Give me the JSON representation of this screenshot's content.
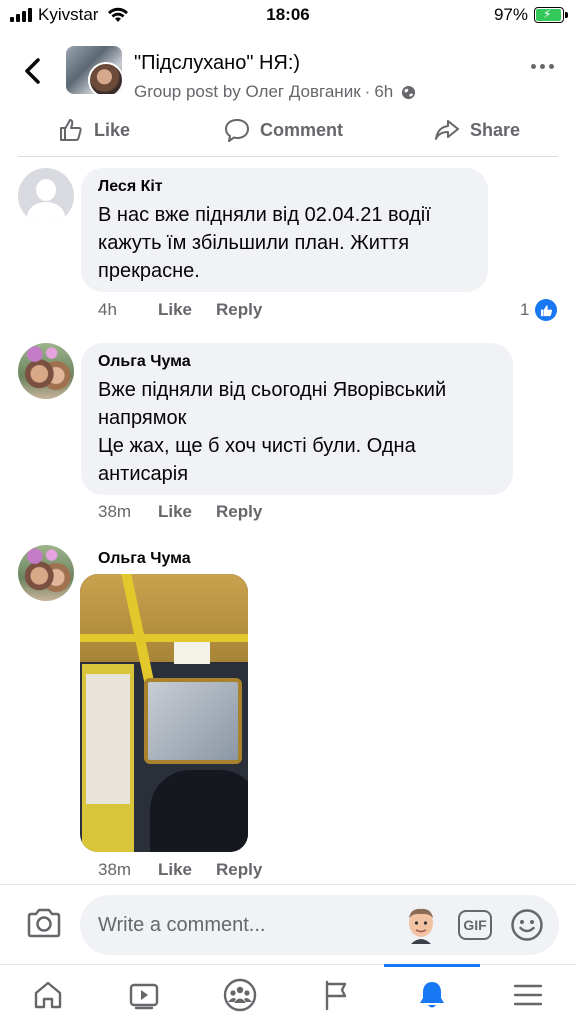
{
  "status_bar": {
    "carrier": "Kyivstar",
    "time": "18:06",
    "battery": "97%",
    "battery_level": 0.97,
    "battery_color": "#34c759"
  },
  "header": {
    "title": "\"Підслухано\" НЯ:)",
    "subtitle_prefix": "Group post by Олег Довганик",
    "separator": "·",
    "time": "6h",
    "icons": [
      "back-icon",
      "globe-icon",
      "more-icon"
    ]
  },
  "actions": {
    "like": "Like",
    "comment": "Comment",
    "share": "Share"
  },
  "comments": [
    {
      "author": "Леся Кіт",
      "text": "В нас вже підняли від 02.04.21 водії\nкажуть їм збільшили план. Життя\nпрекрасне.",
      "time": "4h",
      "like": "Like",
      "reply": "Reply",
      "reaction_count": "1",
      "avatar": "default-avatar"
    },
    {
      "author": "Ольга Чума",
      "text": "Вже підняли від сьогодні Яворівський\nнапрямок\nЦе жах, ще б хоч чисті були. Одна\nантисарія",
      "time": "38m",
      "like": "Like",
      "reply": "Reply",
      "avatar": "photo-avatar"
    },
    {
      "author": "Ольга Чума",
      "text": "",
      "time": "38m",
      "like": "Like",
      "reply": "Reply",
      "avatar": "photo-avatar",
      "attachment": "bus-interior-photo"
    }
  ],
  "composer": {
    "placeholder": "Write a comment...",
    "gif_label": "GIF"
  },
  "tabbar": {
    "tabs": [
      "home-icon",
      "watch-icon",
      "groups-icon",
      "pages-icon",
      "notifications-icon",
      "menu-icon"
    ],
    "active": "notifications-icon"
  },
  "colors": {
    "accent": "#1877f2",
    "secondary_text": "#65676b",
    "bubble": "#f0f2f5"
  }
}
